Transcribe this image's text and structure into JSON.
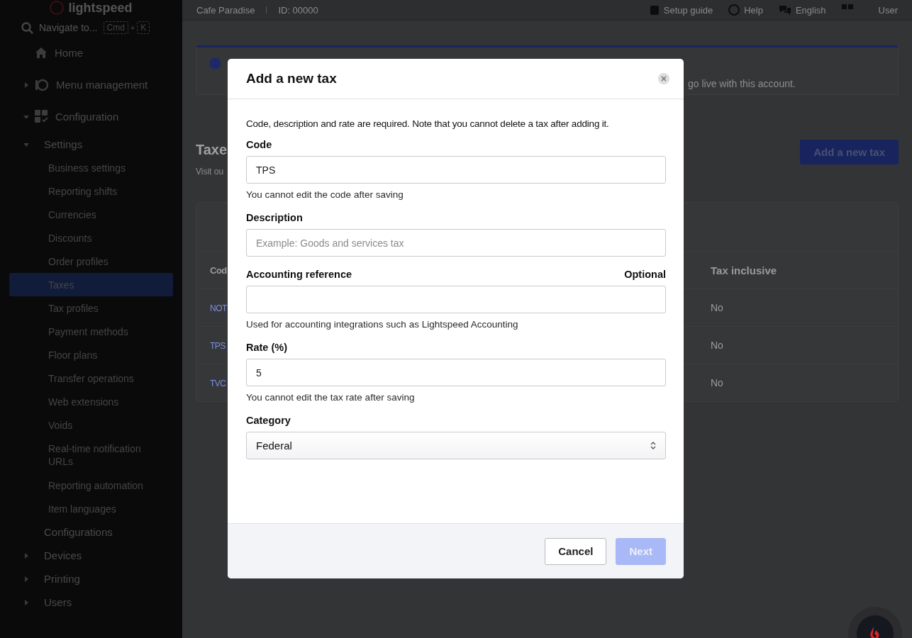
{
  "sidebar": {
    "logo": "lightspeed",
    "search": {
      "placeholder": "Navigate to...",
      "keys": [
        "Cmd",
        "+",
        "K"
      ]
    },
    "items": [
      {
        "label": "Home",
        "selected": false
      },
      {
        "label": "Menu management",
        "selected": false,
        "expanded": false
      },
      {
        "label": "Configuration",
        "selected": false,
        "expanded": true,
        "children": [
          {
            "label": "Settings",
            "selected": false,
            "expanded": true,
            "children": [
              {
                "label": "Business settings",
                "selected": false
              },
              {
                "label": "Reporting shifts",
                "selected": false
              },
              {
                "label": "Currencies",
                "selected": false
              },
              {
                "label": "Discounts",
                "selected": false
              },
              {
                "label": "Order profiles",
                "selected": false
              },
              {
                "label": "Taxes",
                "selected": true
              },
              {
                "label": "Tax profiles",
                "selected": false
              },
              {
                "label": "Payment methods",
                "selected": false
              },
              {
                "label": "Floor plans",
                "selected": false
              },
              {
                "label": "Transfer operations",
                "selected": false
              },
              {
                "label": "Web extensions",
                "selected": false
              },
              {
                "label": "Voids",
                "selected": false
              },
              {
                "label": "Real-time notification URLs",
                "selected": false
              },
              {
                "label": "Reporting automation",
                "selected": false
              },
              {
                "label": "Item languages",
                "selected": false
              }
            ]
          },
          {
            "label": "Configurations",
            "selected": false
          },
          {
            "label": "Devices",
            "selected": false,
            "expanded": false
          },
          {
            "label": "Printing",
            "selected": false,
            "expanded": false
          },
          {
            "label": "Users",
            "selected": false,
            "expanded": false
          }
        ]
      }
    ]
  },
  "top_bar": {
    "business": "Cafe Paradise",
    "id": "ID: 00000",
    "links": [
      {
        "label": "Setup guide"
      },
      {
        "label": "Help"
      },
      {
        "label": "English"
      }
    ],
    "user": "User"
  },
  "banner": {
    "text": "go live with this account."
  },
  "page": {
    "title": "Taxe",
    "subtitle": "Visit ou",
    "add_button": "Add a new tax"
  },
  "table": {
    "columns": [
      "Cod",
      "Tax inclusive"
    ],
    "rows": [
      [
        "NOT",
        "No"
      ],
      [
        "TPS",
        "No"
      ],
      [
        "TVC",
        "No"
      ]
    ]
  },
  "modal": {
    "title": "Add a new tax",
    "intro": "Code, description and rate are required. Note that you cannot delete a tax after adding it.",
    "fields": [
      {
        "kind": "text",
        "label": "Code",
        "value": "TPS",
        "help": "You cannot edit the code after saving"
      },
      {
        "kind": "text",
        "label": "Description",
        "placeholder": "Example: Goods and services tax"
      },
      {
        "kind": "text",
        "label": "Accounting reference",
        "note": "Optional",
        "help": "Used for accounting integrations such as Lightspeed Accounting"
      },
      {
        "kind": "text",
        "label": "Rate (%)",
        "value": "5",
        "help": "You cannot edit the tax rate after saving"
      },
      {
        "kind": "select",
        "label": "Category",
        "value": "Federal"
      }
    ],
    "buttons": [
      {
        "label": "Cancel",
        "kind": "secondary",
        "disabled": false
      },
      {
        "label": "Next",
        "kind": "primary",
        "disabled": true
      }
    ]
  }
}
